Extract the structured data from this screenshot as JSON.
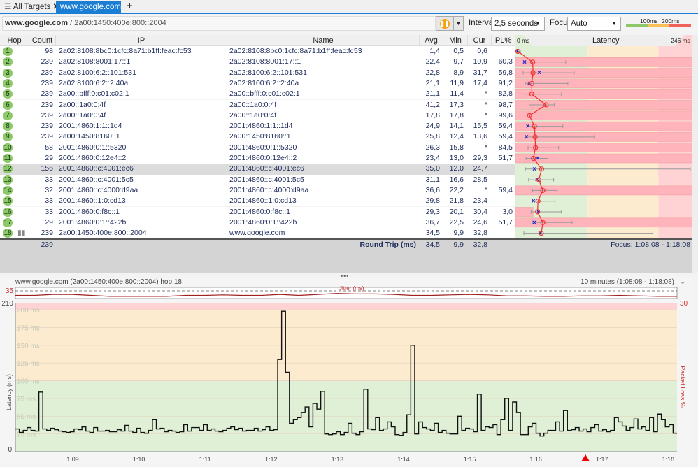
{
  "tabs": {
    "all_targets": "All Targets",
    "active": "www.google.com"
  },
  "address": {
    "target": "www.google.com",
    "separator": " / ",
    "ip": "2a00:1450:400e:800::2004"
  },
  "toolbar": {
    "interval_label": "Interval",
    "interval_value": "2,5 seconds",
    "focus_label": "Focus",
    "focus_value": "Auto",
    "legend_100": "100ms",
    "legend_200": "200ms"
  },
  "colors": {
    "good": "#8dc86a",
    "warn": "#fbbf56",
    "bad": "#f0625a",
    "accent": "#1a7fd4"
  },
  "table": {
    "headers": {
      "hop": "Hop",
      "count": "Count",
      "ip": "IP",
      "name": "Name",
      "avg": "Avg",
      "min": "Min",
      "cur": "Cur",
      "pl": "PL%",
      "latency": "Latency",
      "lat_min": "0 ms",
      "lat_max": "246 ms"
    },
    "latency_scale_max_ms": 246,
    "rows": [
      {
        "hop": "1",
        "count": "98",
        "ip": "2a02:8108:8bc0:1cfc:8a71:b1ff:feac:fc53",
        "name": "2a02:8108:8bc0:1cfc:8a71:b1ff:feac:fc53",
        "avg": "1,4",
        "min": "0,5",
        "cur": "0,6",
        "pl": "",
        "max_ms": 5
      },
      {
        "hop": "2",
        "count": "239",
        "ip": "2a02:8108:8001:17::1",
        "name": "2a02:8108:8001:17::1",
        "avg": "22,4",
        "min": "9,7",
        "cur": "10,9",
        "pl": "60,3",
        "max_ms": 69
      },
      {
        "hop": "3",
        "count": "239",
        "ip": "2a02:8100:6:2::101:531",
        "name": "2a02:8100:6:2::101:531",
        "avg": "22,8",
        "min": "8,9",
        "cur": "31,7",
        "pl": "59,8",
        "max_ms": 81
      },
      {
        "hop": "4",
        "count": "239",
        "ip": "2a02:8100:6:2::2:40a",
        "name": "2a02:8100:6:2::2:40a",
        "avg": "21,1",
        "min": "11,9",
        "cur": "17,4",
        "pl": "91,2",
        "max_ms": 72
      },
      {
        "hop": "5",
        "count": "239",
        "ip": "2a00::bfff:0:c01:c02:1",
        "name": "2a00::bfff:0:c01:c02:1",
        "avg": "21,1",
        "min": "11,4",
        "cur": "*",
        "pl": "82,8",
        "max_ms": 63
      },
      {
        "hop": "6",
        "count": "239",
        "ip": "2a00::1a0:0:4f",
        "name": "2a00::1a0:0:4f",
        "avg": "41,2",
        "min": "17,3",
        "cur": "*",
        "pl": "98,7",
        "max_ms": 53
      },
      {
        "hop": "7",
        "count": "239",
        "ip": "2a00::1a0:0:4f",
        "name": "2a00::1a0:0:4f",
        "avg": "17,8",
        "min": "17,8",
        "cur": "*",
        "pl": "99,6",
        "max_ms": 17.8
      },
      {
        "hop": "8",
        "count": "239",
        "ip": "2001:4860:1:1::1d4",
        "name": "2001:4860:1:1::1d4",
        "avg": "24,9",
        "min": "14,1",
        "cur": "15,5",
        "pl": "59,4",
        "max_ms": 65
      },
      {
        "hop": "9",
        "count": "239",
        "ip": "2a00:1450:8160::1",
        "name": "2a00:1450:8160::1",
        "avg": "25,8",
        "min": "12,4",
        "cur": "13,6",
        "pl": "59,4",
        "max_ms": 110
      },
      {
        "hop": "10",
        "count": "58",
        "ip": "2001:4860:0:1::5320",
        "name": "2001:4860:0:1::5320",
        "avg": "26,3",
        "min": "15,8",
        "cur": "*",
        "pl": "84,5",
        "max_ms": 59
      },
      {
        "hop": "11",
        "count": "29",
        "ip": "2001:4860:0:12e4::2",
        "name": "2001:4860:0:12e4::2",
        "avg": "23,4",
        "min": "13,0",
        "cur": "29,3",
        "pl": "51,7",
        "max_ms": 44
      },
      {
        "hop": "12",
        "count": "156",
        "ip": "2001:4860::c:4001:ec6",
        "name": "2001:4860::c:4001:ec6",
        "avg": "35,0",
        "min": "12,0",
        "cur": "24,7",
        "pl": "",
        "max_ms": 245
      },
      {
        "hop": "13",
        "count": "33",
        "ip": "2001:4860::c:4001:5c5",
        "name": "2001:4860::c:4001:5c5",
        "avg": "31,1",
        "min": "16,6",
        "cur": "28,5",
        "pl": "",
        "max_ms": 52
      },
      {
        "hop": "14",
        "count": "32",
        "ip": "2001:4860::c:4000:d9aa",
        "name": "2001:4860::c:4000:d9aa",
        "avg": "36,6",
        "min": "22,2",
        "cur": "*",
        "pl": "59,4",
        "max_ms": 57
      },
      {
        "hop": "15",
        "count": "33",
        "ip": "2001:4860::1:0:cd13",
        "name": "2001:4860::1:0:cd13",
        "avg": "29,8",
        "min": "21,8",
        "cur": "23,4",
        "pl": "",
        "max_ms": 54
      },
      {
        "hop": "16",
        "count": "33",
        "ip": "2001:4860:0:f8c::1",
        "name": "2001:4860:0:f8c::1",
        "avg": "29,3",
        "min": "20,1",
        "cur": "30,4",
        "pl": "3,0",
        "max_ms": 63
      },
      {
        "hop": "17",
        "count": "29",
        "ip": "2001:4860:0:1::422b",
        "name": "2001:4860:0:1::422b",
        "avg": "36,7",
        "min": "22,5",
        "cur": "24,6",
        "pl": "51,7",
        "max_ms": 78
      },
      {
        "hop": "18",
        "count": "239",
        "ip": "2a00:1450:400e:800::2004",
        "name": "www.google.com",
        "avg": "34,5",
        "min": "9,9",
        "cur": "32,8",
        "pl": "",
        "max_ms": 192
      }
    ],
    "footer": {
      "count": "239",
      "label": "Round Trip (ms)",
      "avg": "34,5",
      "min": "9,9",
      "cur": "32,8",
      "focus": "Focus: 1:08:08 - 1:18:08"
    }
  },
  "chart_data": {
    "type": "line",
    "title": "www.google.com (2a00:1450:400e:800::2004) hop 18",
    "range_label": "10 minutes (1:08:08 - 1:18:08)",
    "ylabel": "Latency (ms)",
    "y2label": "Packet Loss %",
    "ylim": [
      0,
      210
    ],
    "y_top_label": "210",
    "y_zero_label": "0",
    "y2_top_label": "30",
    "grid_labels": [
      "200 ms",
      "175 ms",
      "150 ms",
      "125 ms",
      "100 ms",
      "75 ms",
      "50 ms",
      "25 ms"
    ],
    "x_ticks": [
      "1:09",
      "1:10",
      "1:11",
      "1:12",
      "1:13",
      "1:14",
      "1:15",
      "1:16",
      "1:17",
      "1:18"
    ],
    "x_range": [
      "1:08:08",
      "1:18:08"
    ],
    "jitter": {
      "label": "Jitter (ms)",
      "ref_label": "35",
      "values": [
        5,
        5,
        7,
        7,
        5,
        3,
        3,
        3,
        3,
        5,
        5,
        6,
        5,
        5,
        7,
        5,
        7,
        9,
        8,
        8,
        7,
        5,
        5,
        6,
        7,
        6,
        4,
        4,
        3,
        3,
        4,
        4,
        5,
        4,
        3,
        3
      ]
    },
    "series": [
      {
        "values": [
          32,
          27,
          30,
          34,
          30,
          29,
          84,
          32,
          30,
          33,
          31,
          29,
          28,
          27,
          28,
          32,
          31,
          35,
          29,
          27,
          34,
          29,
          29,
          30,
          28,
          28,
          31,
          29,
          37,
          29,
          27,
          33,
          27,
          26,
          30,
          45,
          32,
          33,
          28,
          30,
          29,
          27,
          28,
          38,
          29,
          34,
          34,
          30,
          38,
          30,
          32,
          29,
          28,
          30,
          33,
          35,
          31,
          33,
          29,
          30,
          30,
          33,
          29,
          31,
          35,
          30,
          31,
          130,
          198,
          112,
          40,
          45,
          48,
          55,
          63,
          35,
          68,
          60,
          85,
          25,
          24,
          25,
          28,
          24,
          27,
          40,
          26,
          24,
          28,
          88,
          32,
          31,
          48,
          30,
          32,
          42,
          35,
          24,
          23,
          27,
          52,
          150,
          25,
          42,
          34,
          32,
          30,
          40,
          27,
          30,
          26,
          25,
          25,
          50,
          30,
          33,
          32,
          28,
          81,
          30,
          35,
          34,
          38,
          24,
          45,
          75,
          30,
          70,
          55,
          24,
          24,
          35,
          40,
          26,
          22,
          26,
          30,
          30,
          42,
          29,
          58,
          30,
          31,
          34,
          29,
          32,
          28,
          34,
          38,
          29,
          31,
          28,
          30,
          48,
          42,
          36,
          30,
          34,
          46,
          32,
          35,
          30,
          48,
          28,
          53,
          45,
          35,
          38,
          26
        ]
      }
    ],
    "marker_time": "1:16:45"
  }
}
